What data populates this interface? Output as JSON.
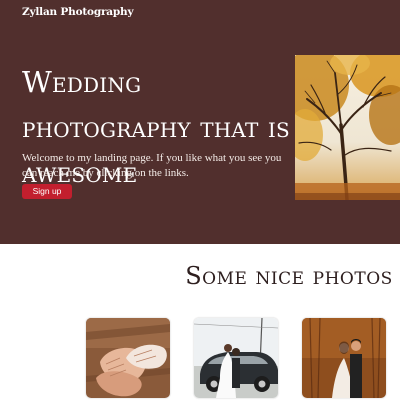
{
  "header": {
    "brand": "Zyllan Photography"
  },
  "hero": {
    "headline": "Wedding photography that is awesome",
    "intro": "Welcome to my landing page. If you like what you see you can reach me by clicking on the links.",
    "signup_label": "Sign up"
  },
  "gallery": {
    "title": "Some nice photos"
  },
  "colors": {
    "hero_background": "#512f2d",
    "button": "#c21f2e",
    "page_background": "#ffffff"
  }
}
